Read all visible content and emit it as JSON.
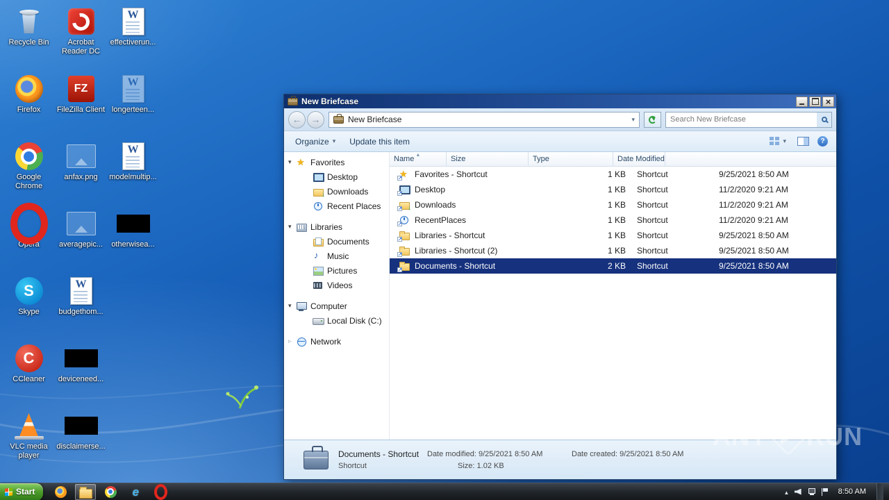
{
  "colors": {
    "selection": "#16317d",
    "wallpaper_top": "#2f83d6",
    "wallpaper_bottom": "#0a3f8e",
    "start_green": "#4b9a2a"
  },
  "desktop": {
    "col1": [
      {
        "label": "Recycle Bin",
        "icon": "recycle-bin"
      },
      {
        "label": "Firefox",
        "icon": "firefox"
      },
      {
        "label": "Google Chrome",
        "icon": "chrome"
      },
      {
        "label": "Opera",
        "icon": "opera"
      },
      {
        "label": "Skype",
        "icon": "skype"
      },
      {
        "label": "CCleaner",
        "icon": "ccleaner"
      },
      {
        "label": "VLC media player",
        "icon": "vlc"
      }
    ],
    "col2": [
      {
        "label": "Acrobat Reader DC",
        "icon": "acrobat"
      },
      {
        "label": "FileZilla Client",
        "icon": "filezilla"
      },
      {
        "label": "anfax.png",
        "icon": "image-faint"
      },
      {
        "label": "averagepic...",
        "icon": "image-faint"
      },
      {
        "label": "budgethom...",
        "icon": "word"
      },
      {
        "label": "deviceneed...",
        "icon": "redacted"
      },
      {
        "label": "disclaimerse...",
        "icon": "redacted"
      }
    ],
    "col3": [
      {
        "label": "effectiverun...",
        "icon": "word"
      },
      {
        "label": "longerteen...",
        "icon": "word-faint"
      },
      {
        "label": "modelmultip...",
        "icon": "word"
      },
      {
        "label": "otherwisea...",
        "icon": "redacted"
      }
    ]
  },
  "explorer": {
    "title": "New Briefcase",
    "breadcrumb": "New Briefcase",
    "search_placeholder": "Search New Briefcase",
    "toolbar": {
      "organize_label": "Organize",
      "update_label": "Update this item"
    },
    "nav_items": [
      {
        "label": "Favorites",
        "icon": "star",
        "expander": "open"
      },
      {
        "label": "Desktop",
        "icon": "desktop",
        "indent": true
      },
      {
        "label": "Downloads",
        "icon": "downloads",
        "indent": true
      },
      {
        "label": "Recent Places",
        "icon": "recent",
        "indent": true
      },
      {
        "label": "Libraries",
        "icon": "libraries",
        "expander": "open",
        "gap": true
      },
      {
        "label": "Documents",
        "icon": "docs",
        "indent": true
      },
      {
        "label": "Music",
        "icon": "music",
        "indent": true
      },
      {
        "label": "Pictures",
        "icon": "pictures",
        "indent": true
      },
      {
        "label": "Videos",
        "icon": "videos",
        "indent": true
      },
      {
        "label": "Computer",
        "icon": "computer",
        "expander": "open",
        "gap": true
      },
      {
        "label": "Local Disk (C:)",
        "icon": "disk",
        "indent": true
      },
      {
        "label": "Network",
        "icon": "network",
        "expander": "closed",
        "gap": true
      }
    ],
    "list": {
      "columns": [
        {
          "label": "Name",
          "sorted": true
        },
        {
          "label": "Size"
        },
        {
          "label": "Type"
        },
        {
          "label": "Date Modified"
        },
        {
          "label": ""
        }
      ],
      "rows": [
        {
          "name": "Favorites - Shortcut",
          "size": "1 KB",
          "type": "Shortcut",
          "modified": "9/25/2021 8:50 AM",
          "icon": "star"
        },
        {
          "name": "Desktop",
          "size": "1 KB",
          "type": "Shortcut",
          "modified": "11/2/2020 9:21 AM",
          "icon": "desktop"
        },
        {
          "name": "Downloads",
          "size": "1 KB",
          "type": "Shortcut",
          "modified": "11/2/2020 9:21 AM",
          "icon": "downloads"
        },
        {
          "name": "RecentPlaces",
          "size": "1 KB",
          "type": "Shortcut",
          "modified": "11/2/2020 9:21 AM",
          "icon": "recent"
        },
        {
          "name": "Libraries - Shortcut",
          "size": "1 KB",
          "type": "Shortcut",
          "modified": "9/25/2021 8:50 AM",
          "icon": "folder"
        },
        {
          "name": "Libraries - Shortcut (2)",
          "size": "1 KB",
          "type": "Shortcut",
          "modified": "9/25/2021 8:50 AM",
          "icon": "folder"
        },
        {
          "name": "Documents - Shortcut",
          "size": "2 KB",
          "type": "Shortcut",
          "modified": "9/25/2021 8:50 AM",
          "icon": "folder",
          "selected": true
        }
      ]
    },
    "details": {
      "name": "Documents - Shortcut",
      "type": "Shortcut",
      "modified_label": "Date modified:",
      "modified_value": "9/25/2021 8:50 AM",
      "created_label": "Date created:",
      "created_value": "9/25/2021 8:50 AM",
      "size_label": "Size:",
      "size_value": "1.02 KB"
    }
  },
  "taskbar": {
    "start_label": "Start",
    "apps": [
      {
        "icon": "firefox"
      },
      {
        "icon": "explorer",
        "active": true
      },
      {
        "icon": "chrome"
      },
      {
        "icon": "ie"
      },
      {
        "icon": "opera"
      }
    ],
    "time": "8:50 AM"
  },
  "watermark": {
    "left": "ANY",
    "right": "RUN"
  }
}
